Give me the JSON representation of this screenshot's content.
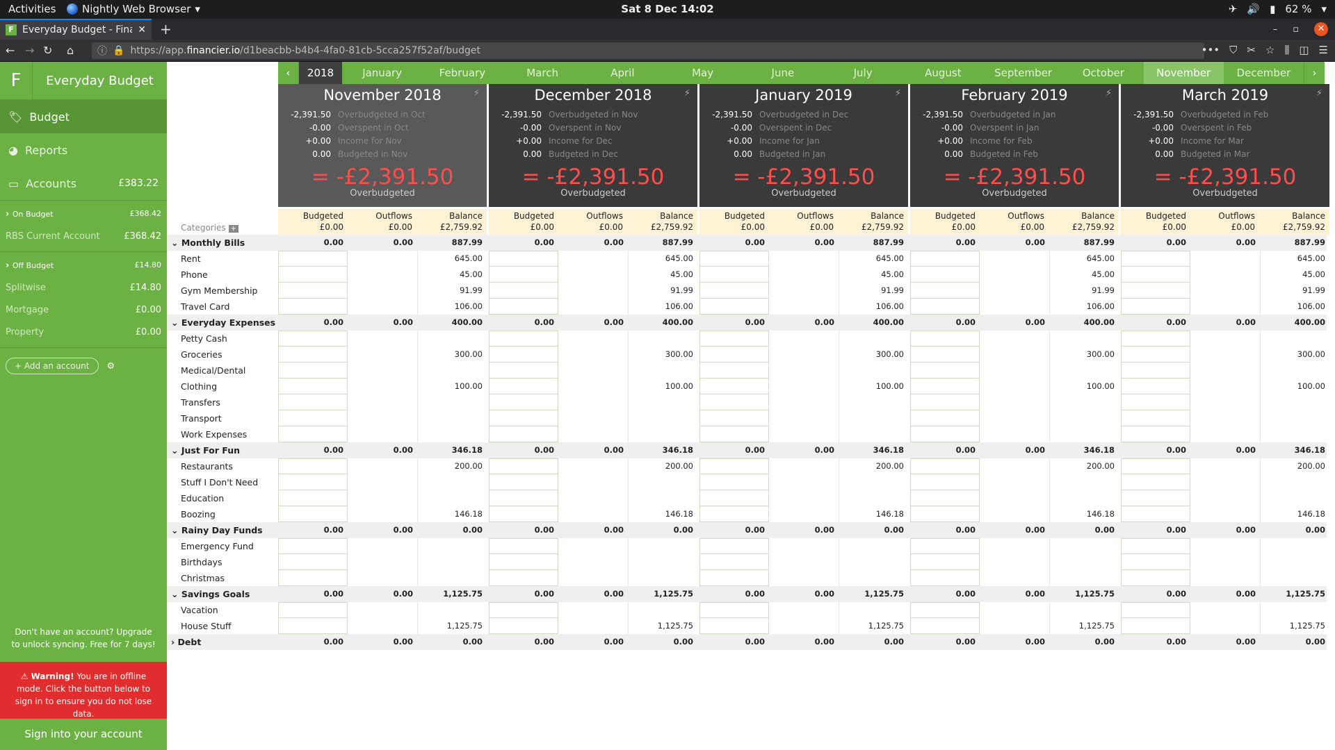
{
  "system": {
    "activities": "Activities",
    "app_name": "Nightly Web Browser",
    "clock": "Sat 8 Dec  14:02",
    "battery": "62 %"
  },
  "browser": {
    "tab_title": "Everyday Budget - Financier",
    "favicon": "F",
    "url_prefix": "https://app.",
    "url_domain": "financier.io",
    "url_path": "/d1beacbb-b4b4-4fa0-81cb-5cca257f52af/budget",
    "new_tab": "+"
  },
  "sidebar": {
    "logo": "F",
    "budget_name": "Everyday Budget",
    "nav": [
      {
        "label": "Budget",
        "icon": "tag-icon",
        "amount": ""
      },
      {
        "label": "Reports",
        "icon": "pie-chart-icon",
        "amount": ""
      },
      {
        "label": "Accounts",
        "icon": "card-icon",
        "amount": "£383.22"
      }
    ],
    "on_budget": {
      "label": "On Budget",
      "amount": "£368.42",
      "accounts": [
        {
          "name": "RBS Current Account",
          "amount": "£368.42"
        }
      ]
    },
    "off_budget": {
      "label": "Off Budget",
      "amount": "£14.80",
      "accounts": [
        {
          "name": "Splitwise",
          "amount": "£14.80"
        },
        {
          "name": "Mortgage",
          "amount": "£0.00"
        },
        {
          "name": "Property",
          "amount": "£0.00"
        }
      ]
    },
    "add_account": "+ Add an account",
    "upgrade": "Don't have an account? Upgrade to unlock syncing. Free for 7 days!",
    "warning_bold": "Warning!",
    "warning_text": " You are in offline mode. Click the button below to sign in to ensure you do not lose data.",
    "sign_in": "Sign into your account"
  },
  "month_nav": {
    "year": "2018",
    "months": [
      "January",
      "February",
      "March",
      "April",
      "May",
      "June",
      "July",
      "August",
      "September",
      "October",
      "November",
      "December"
    ],
    "current": "November"
  },
  "categories_label": "Categories",
  "col_labels": {
    "budgeted": "Budgeted",
    "outflows": "Outflows",
    "balance": "Balance"
  },
  "months": [
    {
      "title": "November 2018",
      "prev": "Oct",
      "cur": "Nov",
      "over": "-2,391.50",
      "overspent": "-0.00",
      "income": "+0.00",
      "budgeted": "0.00",
      "total": "= -£2,391.50",
      "total_label": "Overbudgeted",
      "tot_budgeted": "£0.00",
      "tot_outflows": "£0.00",
      "tot_balance": "£2,759.92"
    },
    {
      "title": "December 2018",
      "prev": "Nov",
      "cur": "Dec",
      "over": "-2,391.50",
      "overspent": "-0.00",
      "income": "+0.00",
      "budgeted": "0.00",
      "total": "= -£2,391.50",
      "total_label": "Overbudgeted",
      "tot_budgeted": "£0.00",
      "tot_outflows": "£0.00",
      "tot_balance": "£2,759.92"
    },
    {
      "title": "January 2019",
      "prev": "Dec",
      "cur": "Jan",
      "over": "-2,391.50",
      "overspent": "-0.00",
      "income": "+0.00",
      "budgeted": "0.00",
      "total": "= -£2,391.50",
      "total_label": "Overbudgeted",
      "tot_budgeted": "£0.00",
      "tot_outflows": "£0.00",
      "tot_balance": "£2,759.92"
    },
    {
      "title": "February 2019",
      "prev": "Jan",
      "cur": "Feb",
      "over": "-2,391.50",
      "overspent": "-0.00",
      "income": "+0.00",
      "budgeted": "0.00",
      "total": "= -£2,391.50",
      "total_label": "Overbudgeted",
      "tot_budgeted": "£0.00",
      "tot_outflows": "£0.00",
      "tot_balance": "£2,759.92"
    },
    {
      "title": "March 2019",
      "prev": "Feb",
      "cur": "Mar",
      "over": "-2,391.50",
      "overspent": "-0.00",
      "income": "+0.00",
      "budgeted": "0.00",
      "total": "= -£2,391.50",
      "total_label": "Overbudgeted",
      "tot_budgeted": "£0.00",
      "tot_outflows": "£0.00",
      "tot_balance": "£2,759.92"
    }
  ],
  "summary_labels": {
    "over": "Overbudgeted in",
    "overspent": "Overspent in",
    "income": "Income for",
    "budgeted": "Budgeted in"
  },
  "groups": [
    {
      "name": "Monthly Bills",
      "budgeted": "0.00",
      "outflows": "0.00",
      "balance": "887.99",
      "items": [
        {
          "name": "Rent",
          "balance": "645.00"
        },
        {
          "name": "Phone",
          "balance": "45.00"
        },
        {
          "name": "Gym Membership",
          "balance": "91.99"
        },
        {
          "name": "Travel Card",
          "balance": "106.00"
        }
      ]
    },
    {
      "name": "Everyday Expenses",
      "budgeted": "0.00",
      "outflows": "0.00",
      "balance": "400.00",
      "items": [
        {
          "name": "Petty Cash",
          "balance": ""
        },
        {
          "name": "Groceries",
          "balance": "300.00"
        },
        {
          "name": "Medical/Dental",
          "balance": ""
        },
        {
          "name": "Clothing",
          "balance": "100.00"
        },
        {
          "name": "Transfers",
          "balance": ""
        },
        {
          "name": "Transport",
          "balance": ""
        },
        {
          "name": "Work Expenses",
          "balance": ""
        }
      ]
    },
    {
      "name": "Just For Fun",
      "budgeted": "0.00",
      "outflows": "0.00",
      "balance": "346.18",
      "items": [
        {
          "name": "Restaurants",
          "balance": "200.00"
        },
        {
          "name": "Stuff I Don't Need",
          "balance": ""
        },
        {
          "name": "Education",
          "balance": ""
        },
        {
          "name": "Boozing",
          "balance": "146.18"
        }
      ]
    },
    {
      "name": "Rainy Day Funds",
      "budgeted": "0.00",
      "outflows": "0.00",
      "balance": "0.00",
      "items": [
        {
          "name": "Emergency Fund",
          "balance": ""
        },
        {
          "name": "Birthdays",
          "balance": ""
        },
        {
          "name": "Christmas",
          "balance": ""
        }
      ]
    },
    {
      "name": "Savings Goals",
      "budgeted": "0.00",
      "outflows": "0.00",
      "balance": "1,125.75",
      "items": [
        {
          "name": "Vacation",
          "balance": ""
        },
        {
          "name": "House Stuff",
          "balance": "1,125.75"
        }
      ]
    },
    {
      "name": "Debt",
      "budgeted": "0.00",
      "outflows": "0.00",
      "balance": "0.00",
      "collapsed": true,
      "items": []
    }
  ]
}
